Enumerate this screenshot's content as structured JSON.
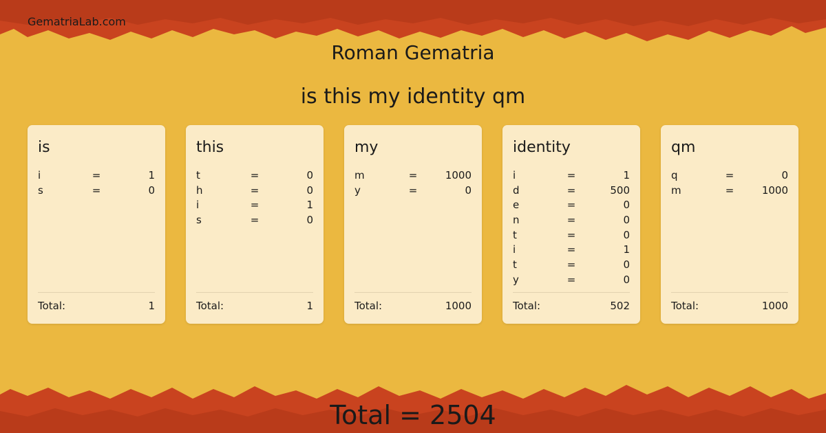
{
  "site_name": "GematriaLab.com",
  "title": "Roman Gematria",
  "phrase": "is this my identity qm",
  "total_label": "Total:",
  "grand_total": "Total = 2504",
  "colors": {
    "background": "#e9b23a",
    "border_red": "#c9431f",
    "card_bg": "#fcefd2"
  },
  "words": [
    {
      "word": "is",
      "letters": [
        {
          "letter": "i",
          "eq": "=",
          "value": "1"
        },
        {
          "letter": "s",
          "eq": "=",
          "value": "0"
        }
      ],
      "total": "1"
    },
    {
      "word": "this",
      "letters": [
        {
          "letter": "t",
          "eq": "=",
          "value": "0"
        },
        {
          "letter": "h",
          "eq": "=",
          "value": "0"
        },
        {
          "letter": "i",
          "eq": "=",
          "value": "1"
        },
        {
          "letter": "s",
          "eq": "=",
          "value": "0"
        }
      ],
      "total": "1"
    },
    {
      "word": "my",
      "letters": [
        {
          "letter": "m",
          "eq": "=",
          "value": "1000"
        },
        {
          "letter": "y",
          "eq": "=",
          "value": "0"
        }
      ],
      "total": "1000"
    },
    {
      "word": "identity",
      "letters": [
        {
          "letter": "i",
          "eq": "=",
          "value": "1"
        },
        {
          "letter": "d",
          "eq": "=",
          "value": "500"
        },
        {
          "letter": "e",
          "eq": "=",
          "value": "0"
        },
        {
          "letter": "n",
          "eq": "=",
          "value": "0"
        },
        {
          "letter": "t",
          "eq": "=",
          "value": "0"
        },
        {
          "letter": "i",
          "eq": "=",
          "value": "1"
        },
        {
          "letter": "t",
          "eq": "=",
          "value": "0"
        },
        {
          "letter": "y",
          "eq": "=",
          "value": "0"
        }
      ],
      "total": "502"
    },
    {
      "word": "qm",
      "letters": [
        {
          "letter": "q",
          "eq": "=",
          "value": "0"
        },
        {
          "letter": "m",
          "eq": "=",
          "value": "1000"
        }
      ],
      "total": "1000"
    }
  ]
}
